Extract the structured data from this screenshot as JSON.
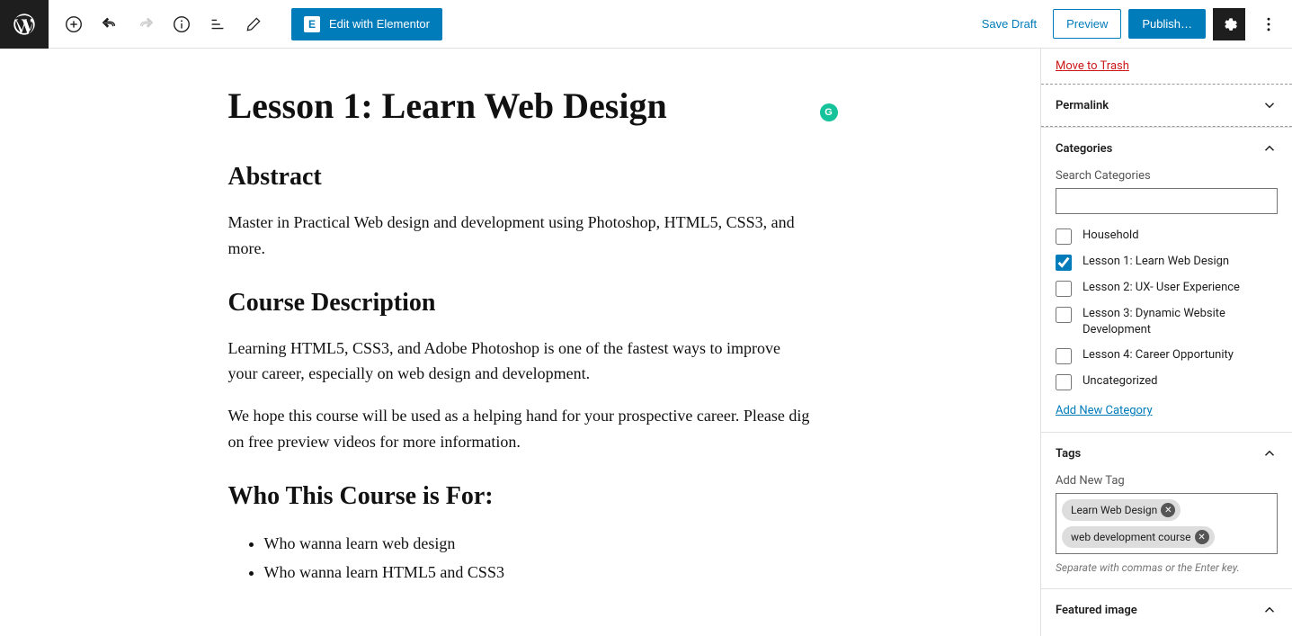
{
  "toolbar": {
    "elementor_label": "Edit with Elementor",
    "save_draft": "Save Draft",
    "preview": "Preview",
    "publish": "Publish…"
  },
  "post": {
    "title": "Lesson 1: Learn Web Design",
    "h_abstract": "Abstract",
    "p_abstract": "Master in Practical Web design and development using Photoshop, HTML5, CSS3, and more.",
    "h_desc": "Course Description",
    "p_desc1": "Learning HTML5, CSS3, and Adobe Photoshop is one of the fastest ways to improve your career, especially on web design and development.",
    "p_desc2": "We hope this course will be used as a helping hand for your prospective career. Please dig on free preview videos for more information.",
    "h_who": "Who This Course is For:",
    "li_who1": "Who wanna learn web design",
    "li_who2": "Who wanna learn HTML5 and CSS3"
  },
  "sidebar": {
    "trash": "Move to Trash",
    "permalink_title": "Permalink",
    "categories_title": "Categories",
    "search_cat_label": "Search Categories",
    "cats": {
      "c0": "Household",
      "c1": "Lesson 1: Learn Web Design",
      "c2": "Lesson 2: UX- User Experience",
      "c3": "Lesson 3: Dynamic Website Development",
      "c4": "Lesson 4: Career Opportunity",
      "c5": "Uncategorized"
    },
    "add_category": "Add New Category",
    "tags_title": "Tags",
    "add_tag_label": "Add New Tag",
    "tags": {
      "t0": "Learn Web Design",
      "t1": "web development course"
    },
    "tags_hint": "Separate with commas or the Enter key.",
    "featured_title": "Featured image"
  }
}
